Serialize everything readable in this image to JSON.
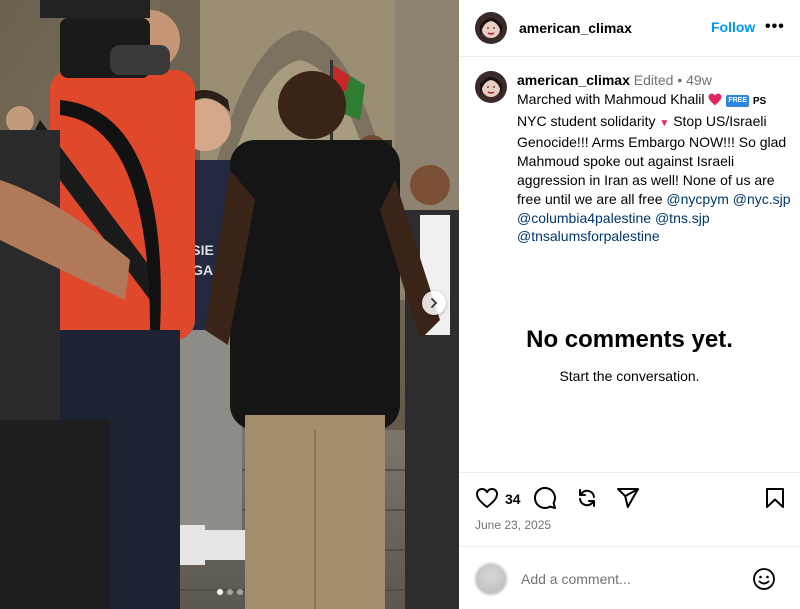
{
  "post": {
    "username": "american_climax",
    "follow_label": "Follow",
    "more_label": "•••",
    "caption": {
      "edited_label": "Edited",
      "separator": "•",
      "age": "49w",
      "text_1": "Marched with Mahmoud Khalil",
      "free_badge": "FREE",
      "ps_text": "PS",
      "text_2": "NYC student solidarity",
      "text_3": "Stop US/Israeli Genocide!!! Arms Embargo NOW!!! So glad Mahmoud spoke out against Israeli aggression in Iran as well! None of us are free until we are all free",
      "mentions": [
        "@nycpym",
        "@nyc.sjp",
        "@columbia4palestine",
        "@tns.sjp",
        "@tnsalumsforpalestine"
      ]
    },
    "empty_title": "No comments yet.",
    "empty_subtitle": "Start the conversation.",
    "like_count": "34",
    "date": "June 23, 2025",
    "comment_placeholder": "Add a comment...",
    "carousel": {
      "total": 3,
      "active": 1
    }
  },
  "icons": {
    "heart": "heart-icon",
    "comment": "comment-icon",
    "repost": "repost-icon",
    "share": "share-icon",
    "save": "bookmark-icon",
    "emoji": "emoji-icon",
    "next": "chevron-right-icon"
  },
  "colors": {
    "link": "#0095f6",
    "mention": "#00376b",
    "meta": "#737373",
    "heart_red": "#e0245e"
  }
}
